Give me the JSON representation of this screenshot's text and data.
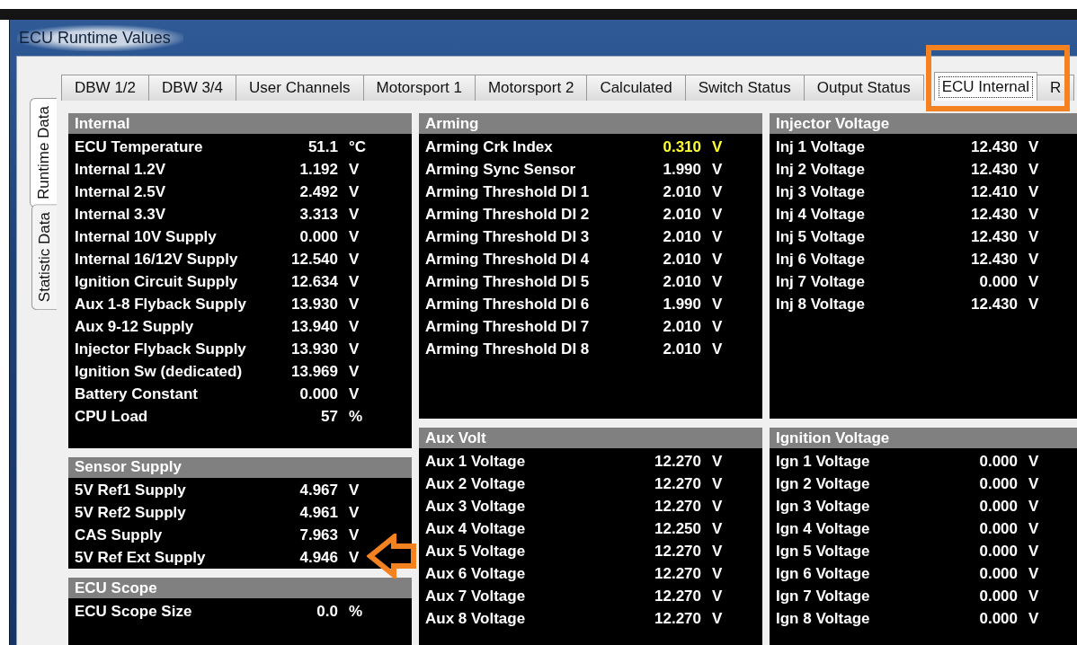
{
  "window": {
    "title": "ECU Runtime Values"
  },
  "side_tabs": [
    {
      "label": "Runtime Data",
      "selected": true
    },
    {
      "label": "Statistic Data",
      "selected": false
    }
  ],
  "tabs": [
    {
      "label": "DBW 1/2",
      "selected": false
    },
    {
      "label": "DBW 3/4",
      "selected": false
    },
    {
      "label": "User Channels",
      "selected": false
    },
    {
      "label": "Motorsport 1",
      "selected": false
    },
    {
      "label": "Motorsport 2",
      "selected": false
    },
    {
      "label": "Calculated",
      "selected": false
    },
    {
      "label": "Switch Status",
      "selected": false
    },
    {
      "label": "Output Status",
      "selected": false
    },
    {
      "label": "ECU Internal",
      "selected": true
    },
    {
      "label": "R",
      "selected": false
    }
  ],
  "columns": [
    {
      "panels": [
        {
          "title": "Internal",
          "rows": [
            {
              "label": "ECU Temperature",
              "value": "51.1",
              "unit": "°C",
              "alert": false
            },
            {
              "label": "Internal 1.2V",
              "value": "1.192",
              "unit": "V",
              "alert": false
            },
            {
              "label": "Internal 2.5V",
              "value": "2.492",
              "unit": "V",
              "alert": false
            },
            {
              "label": "Internal 3.3V",
              "value": "3.313",
              "unit": "V",
              "alert": false
            },
            {
              "label": "Internal 10V Supply",
              "value": "0.000",
              "unit": "V",
              "alert": false
            },
            {
              "label": "Internal 16/12V Supply",
              "value": "12.540",
              "unit": "V",
              "alert": false
            },
            {
              "label": "Ignition Circuit Supply",
              "value": "12.634",
              "unit": "V",
              "alert": false
            },
            {
              "label": "Aux 1-8 Flyback Supply",
              "value": "13.930",
              "unit": "V",
              "alert": false
            },
            {
              "label": "Aux 9-12 Supply",
              "value": "13.940",
              "unit": "V",
              "alert": false
            },
            {
              "label": "Injector Flyback Supply",
              "value": "13.930",
              "unit": "V",
              "alert": false
            },
            {
              "label": "Ignition Sw (dedicated)",
              "value": "13.969",
              "unit": "V",
              "alert": false
            },
            {
              "label": "Battery Constant",
              "value": "0.000",
              "unit": "V",
              "alert": false
            },
            {
              "label": "CPU Load",
              "value": "57",
              "unit": "%",
              "alert": false
            }
          ]
        },
        {
          "title": "Sensor Supply",
          "rows": [
            {
              "label": "5V Ref1 Supply",
              "value": "4.967",
              "unit": "V",
              "alert": false
            },
            {
              "label": "5V Ref2 Supply",
              "value": "4.961",
              "unit": "V",
              "alert": false
            },
            {
              "label": "CAS Supply",
              "value": "7.963",
              "unit": "V",
              "alert": false
            },
            {
              "label": "5V Ref Ext Supply",
              "value": "4.946",
              "unit": "V",
              "alert": false
            }
          ]
        },
        {
          "title": "ECU Scope",
          "rows": [
            {
              "label": "ECU Scope Size",
              "value": "0.0",
              "unit": "%",
              "alert": false
            }
          ]
        }
      ]
    },
    {
      "panels": [
        {
          "title": "Arming",
          "rows": [
            {
              "label": "Arming Crk Index",
              "value": "0.310",
              "unit": "V",
              "alert": true
            },
            {
              "label": "Arming Sync Sensor",
              "value": "1.990",
              "unit": "V",
              "alert": false
            },
            {
              "label": "Arming Threshold DI 1",
              "value": "2.010",
              "unit": "V",
              "alert": false
            },
            {
              "label": "Arming Threshold DI 2",
              "value": "2.010",
              "unit": "V",
              "alert": false
            },
            {
              "label": "Arming Threshold DI 3",
              "value": "2.010",
              "unit": "V",
              "alert": false
            },
            {
              "label": "Arming Threshold DI 4",
              "value": "2.010",
              "unit": "V",
              "alert": false
            },
            {
              "label": "Arming Threshold DI 5",
              "value": "2.010",
              "unit": "V",
              "alert": false
            },
            {
              "label": "Arming Threshold DI 6",
              "value": "1.990",
              "unit": "V",
              "alert": false
            },
            {
              "label": "Arming Threshold DI 7",
              "value": "2.010",
              "unit": "V",
              "alert": false
            },
            {
              "label": "Arming Threshold DI 8",
              "value": "2.010",
              "unit": "V",
              "alert": false
            }
          ]
        },
        {
          "title": "Aux Volt",
          "rows": [
            {
              "label": "Aux 1 Voltage",
              "value": "12.270",
              "unit": "V",
              "alert": false
            },
            {
              "label": "Aux 2 Voltage",
              "value": "12.270",
              "unit": "V",
              "alert": false
            },
            {
              "label": "Aux 3 Voltage",
              "value": "12.270",
              "unit": "V",
              "alert": false
            },
            {
              "label": "Aux 4 Voltage",
              "value": "12.250",
              "unit": "V",
              "alert": false
            },
            {
              "label": "Aux 5 Voltage",
              "value": "12.270",
              "unit": "V",
              "alert": false
            },
            {
              "label": "Aux 6 Voltage",
              "value": "12.270",
              "unit": "V",
              "alert": false
            },
            {
              "label": "Aux 7 Voltage",
              "value": "12.270",
              "unit": "V",
              "alert": false
            },
            {
              "label": "Aux 8 Voltage",
              "value": "12.270",
              "unit": "V",
              "alert": false
            }
          ]
        }
      ]
    },
    {
      "panels": [
        {
          "title": "Injector Voltage",
          "rows": [
            {
              "label": "Inj 1 Voltage",
              "value": "12.430",
              "unit": "V",
              "alert": false
            },
            {
              "label": "Inj 2 Voltage",
              "value": "12.430",
              "unit": "V",
              "alert": false
            },
            {
              "label": "Inj 3 Voltage",
              "value": "12.410",
              "unit": "V",
              "alert": false
            },
            {
              "label": "Inj 4 Voltage",
              "value": "12.430",
              "unit": "V",
              "alert": false
            },
            {
              "label": "Inj 5 Voltage",
              "value": "12.430",
              "unit": "V",
              "alert": false
            },
            {
              "label": "Inj 6 Voltage",
              "value": "12.430",
              "unit": "V",
              "alert": false
            },
            {
              "label": "Inj 7 Voltage",
              "value": "0.000",
              "unit": "V",
              "alert": false
            },
            {
              "label": "Inj 8 Voltage",
              "value": "12.430",
              "unit": "V",
              "alert": false
            }
          ]
        },
        {
          "title": "Ignition Voltage",
          "rows": [
            {
              "label": "Ign 1 Voltage",
              "value": "0.000",
              "unit": "V",
              "alert": false
            },
            {
              "label": "Ign 2 Voltage",
              "value": "0.000",
              "unit": "V",
              "alert": false
            },
            {
              "label": "Ign 3 Voltage",
              "value": "0.000",
              "unit": "V",
              "alert": false
            },
            {
              "label": "Ign 4 Voltage",
              "value": "0.000",
              "unit": "V",
              "alert": false
            },
            {
              "label": "Ign 5 Voltage",
              "value": "0.000",
              "unit": "V",
              "alert": false
            },
            {
              "label": "Ign 6 Voltage",
              "value": "0.000",
              "unit": "V",
              "alert": false
            },
            {
              "label": "Ign 7 Voltage",
              "value": "0.000",
              "unit": "V",
              "alert": false
            },
            {
              "label": "Ign 8 Voltage",
              "value": "0.000",
              "unit": "V",
              "alert": false
            }
          ]
        }
      ]
    }
  ],
  "annotations": {
    "tab_highlight": true,
    "value_arrow": true
  }
}
